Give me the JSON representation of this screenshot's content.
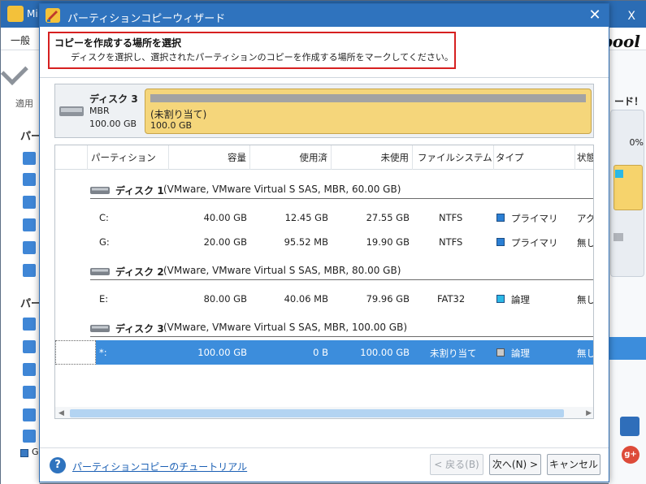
{
  "background_app": {
    "title": "Mi",
    "window_controls": "ロ X",
    "menu_first": "一般",
    "brand": "pool",
    "apply_label": "適用",
    "section1": "パー",
    "section2": "パー",
    "right_excl": "ード！",
    "right_pct": "0%",
    "bottom_label": "G"
  },
  "dialog": {
    "title": "パーティションコピーウィザード",
    "close": "✕",
    "header_title": "コピーを作成する場所を選択",
    "header_subtitle": "ディスクを選択し、選択されたパーティションのコピーを作成する場所をマークしてください。"
  },
  "disk_map": {
    "name": "ディスク 3",
    "type": "MBR",
    "size": "100.00 GB",
    "partition_label": "(未割り当て)",
    "partition_size": "100.0 GB",
    "partition_color": "#f5d67b"
  },
  "table": {
    "columns": [
      "パーティション",
      "容量",
      "使用済",
      "未使用",
      "ファイルシステム",
      "タイプ",
      "状態"
    ],
    "disks": [
      {
        "name": "ディスク 1",
        "info": "(VMware, VMware Virtual S SAS, MBR, 60.00 GB)",
        "partitions": [
          {
            "part": "C:",
            "capacity": "40.00 GB",
            "used": "12.45 GB",
            "unused": "27.55 GB",
            "fs": "NTFS",
            "type": "プライマリ",
            "status": "アク",
            "type_color": "#2b7fd4"
          },
          {
            "part": "G:",
            "capacity": "20.00 GB",
            "used": "95.52 MB",
            "unused": "19.90 GB",
            "fs": "NTFS",
            "type": "プライマリ",
            "status": "無し",
            "type_color": "#2b7fd4"
          }
        ]
      },
      {
        "name": "ディスク 2",
        "info": "(VMware, VMware Virtual S SAS, MBR, 80.00 GB)",
        "partitions": [
          {
            "part": "E:",
            "capacity": "80.00 GB",
            "used": "40.06 MB",
            "unused": "79.96 GB",
            "fs": "FAT32",
            "type": "論理",
            "status": "無し",
            "type_color": "#2bb8e6"
          }
        ]
      },
      {
        "name": "ディスク 3",
        "info": "(VMware, VMware Virtual S SAS, MBR, 100.00 GB)",
        "partitions": [
          {
            "part": "*:",
            "capacity": "100.00 GB",
            "used": "0 B",
            "unused": "100.00 GB",
            "fs": "未割り当て",
            "type": "論理",
            "status": "無し",
            "type_color": "#c9c9c9",
            "selected": true
          }
        ]
      }
    ]
  },
  "footer": {
    "tutorial_link": "パーティションコピーのチュートリアル",
    "back_button": "< 戻る(B)",
    "next_button": "次へ(N) >",
    "cancel_button": "キャンセル"
  },
  "colors": {
    "title_bar": "#2f73be",
    "selection": "#3c8ddc",
    "header_border": "#d62020"
  }
}
